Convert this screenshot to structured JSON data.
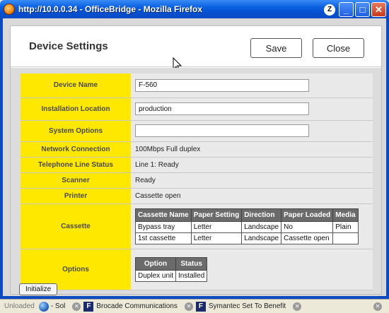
{
  "window": {
    "title": "http://10.0.0.34 - OfficeBridge - Mozilla Firefox",
    "minimize": "_",
    "maximize": "□",
    "close": "✕"
  },
  "page": {
    "title": "Device Settings",
    "save_label": "Save",
    "close_label": "Close",
    "initialize_label": "Initialize"
  },
  "fields": {
    "device_name": {
      "label": "Device Name",
      "value": "F-560"
    },
    "installation_location": {
      "label": "Installation Location",
      "value": "production"
    },
    "system_options": {
      "label": "System Options",
      "value": ""
    },
    "network_connection": {
      "label": "Network Connection",
      "value": "100Mbps Full duplex"
    },
    "telephone_line_status": {
      "label": "Telephone Line Status",
      "value": "Line 1: Ready"
    },
    "scanner": {
      "label": "Scanner",
      "value": "Ready"
    },
    "printer": {
      "label": "Printer",
      "value": "Cassette open"
    },
    "cassette": {
      "label": "Cassette"
    },
    "options": {
      "label": "Options"
    }
  },
  "cassette_table": {
    "headers": [
      "Cassette Name",
      "Paper Setting",
      "Direction",
      "Paper Loaded",
      "Media"
    ],
    "rows": [
      [
        "Bypass tray",
        "Letter",
        "Landscape",
        "No",
        "Plain"
      ],
      [
        "1st cassette",
        "Letter",
        "Landscape",
        "Cassette open",
        ""
      ]
    ]
  },
  "options_table": {
    "headers": [
      "Option",
      "Status"
    ],
    "rows": [
      [
        "Duplex unit",
        "Installed"
      ]
    ]
  },
  "statusbar": {
    "unloaded": "Unloaded",
    "item1": "- Sol",
    "item2": "Brocade Communications",
    "item3": "Symantec Set To Benefit"
  },
  "icons": {
    "app": "firefox-icon",
    "status_globe": "globe-icon",
    "feed": "f-logo-icon",
    "close_tab": "close-circle-icon"
  }
}
